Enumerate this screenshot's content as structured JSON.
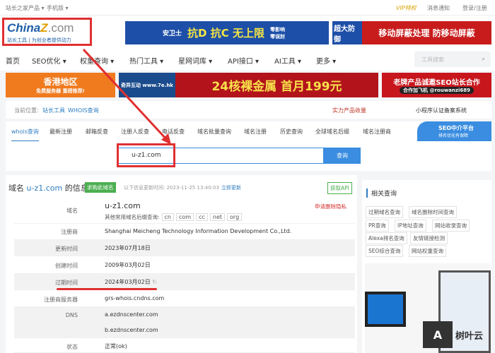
{
  "topbar": {
    "products": "站长之家产品 ▾",
    "mobile": "手机版 ▾",
    "vip": "VIP特权",
    "messages": "消息通知",
    "login": "登录/注册"
  },
  "logo": {
    "text": "China",
    "z": "Z",
    "com": ".com",
    "slogan": "站长工具 | 为创业者提供动力"
  },
  "ads": {
    "a1_brand": "安卫士",
    "a1_main": "抗D 抗C 无上限",
    "a1_side": "零影响 零误封",
    "a2_left": "超大防御",
    "a2_main": "移动屏蔽处理 防移动屏蔽",
    "b1_top": "香港地区",
    "b1_sub": "免费服务器 重磅推荐!",
    "b2_brand": "奇异互动 www.7e.hk",
    "b2_main": "24核裸金属 首月199元",
    "b3_main": "老牌产品诚邀SEO站长合作",
    "b3_sub": "合作加飞机 @rouwanzi689"
  },
  "nav": [
    "首页",
    "SEO优化 ▾",
    "权重查询 ▾",
    "热门工具 ▾",
    "星网词库 ▾",
    "API接口 ▾",
    "AI工具 ▾",
    "更多 ▾"
  ],
  "tool_search_placeholder": "工具搜索",
  "breadcrumb": {
    "prefix": "当前位置:",
    "l1": "站长工具",
    "l2": "WHOIS查询",
    "ad1": "实力产品收量",
    "ad2": "小程序认证备案系统"
  },
  "tabs": [
    "whois查询",
    "最新注册",
    "邮箱反查",
    "注册人反查",
    "电话反查",
    "域名批量查询",
    "域名注册",
    "历史查询",
    "全球域名后缀",
    "域名注册商"
  ],
  "seo_badge": {
    "title": "SEO中介平台",
    "sub": "排名优化有保障"
  },
  "search": {
    "value": "u-z1.com",
    "button": "查询"
  },
  "info": {
    "title_prefix": "域名",
    "domain": "u-z1.com",
    "title_suffix": "的信息",
    "buy": "求购此域名",
    "updated": "以下信息更新时间: 2023-11-25 13:40:03",
    "refresh": "立即更新",
    "api": "获取API",
    "privacy": "申请删除隐私",
    "other_suffix": "其他常用域名后缀查询:",
    "suffixes": [
      "cn",
      "com",
      "cc",
      "net",
      "org"
    ]
  },
  "rows": [
    {
      "label": "域名",
      "value": "u-z1.com"
    },
    {
      "label": "注册商",
      "value": "Shanghai Meicheng Technology Information Development Co.,Ltd."
    },
    {
      "label": "更新时间",
      "value": "2023年07月18日"
    },
    {
      "label": "创建时间",
      "value": "2009年03月02日"
    },
    {
      "label": "过期时间",
      "value": "2024年03月02日"
    },
    {
      "label": "注册商服务器",
      "value": "grs-whois.cndns.com"
    },
    {
      "label": "DNS",
      "value": "a.ezdnscenter.com",
      "value2": "b.ezdnscenter.com"
    },
    {
      "label": "状态",
      "value": "正常(ok)"
    }
  ],
  "side": {
    "title": "相关查询",
    "links": [
      "过期域名查询",
      "域名删除时间查询",
      "PR查询",
      "IP地址查询",
      "网站收录查询",
      "Alexa排名查询",
      "友情链接检测",
      "SEO综合查询",
      "网站权重查询"
    ]
  },
  "watermark": "树叶云",
  "colors": {
    "accent": "#2d7cc1",
    "annotation": "#e03030",
    "green": "#4caf50"
  }
}
